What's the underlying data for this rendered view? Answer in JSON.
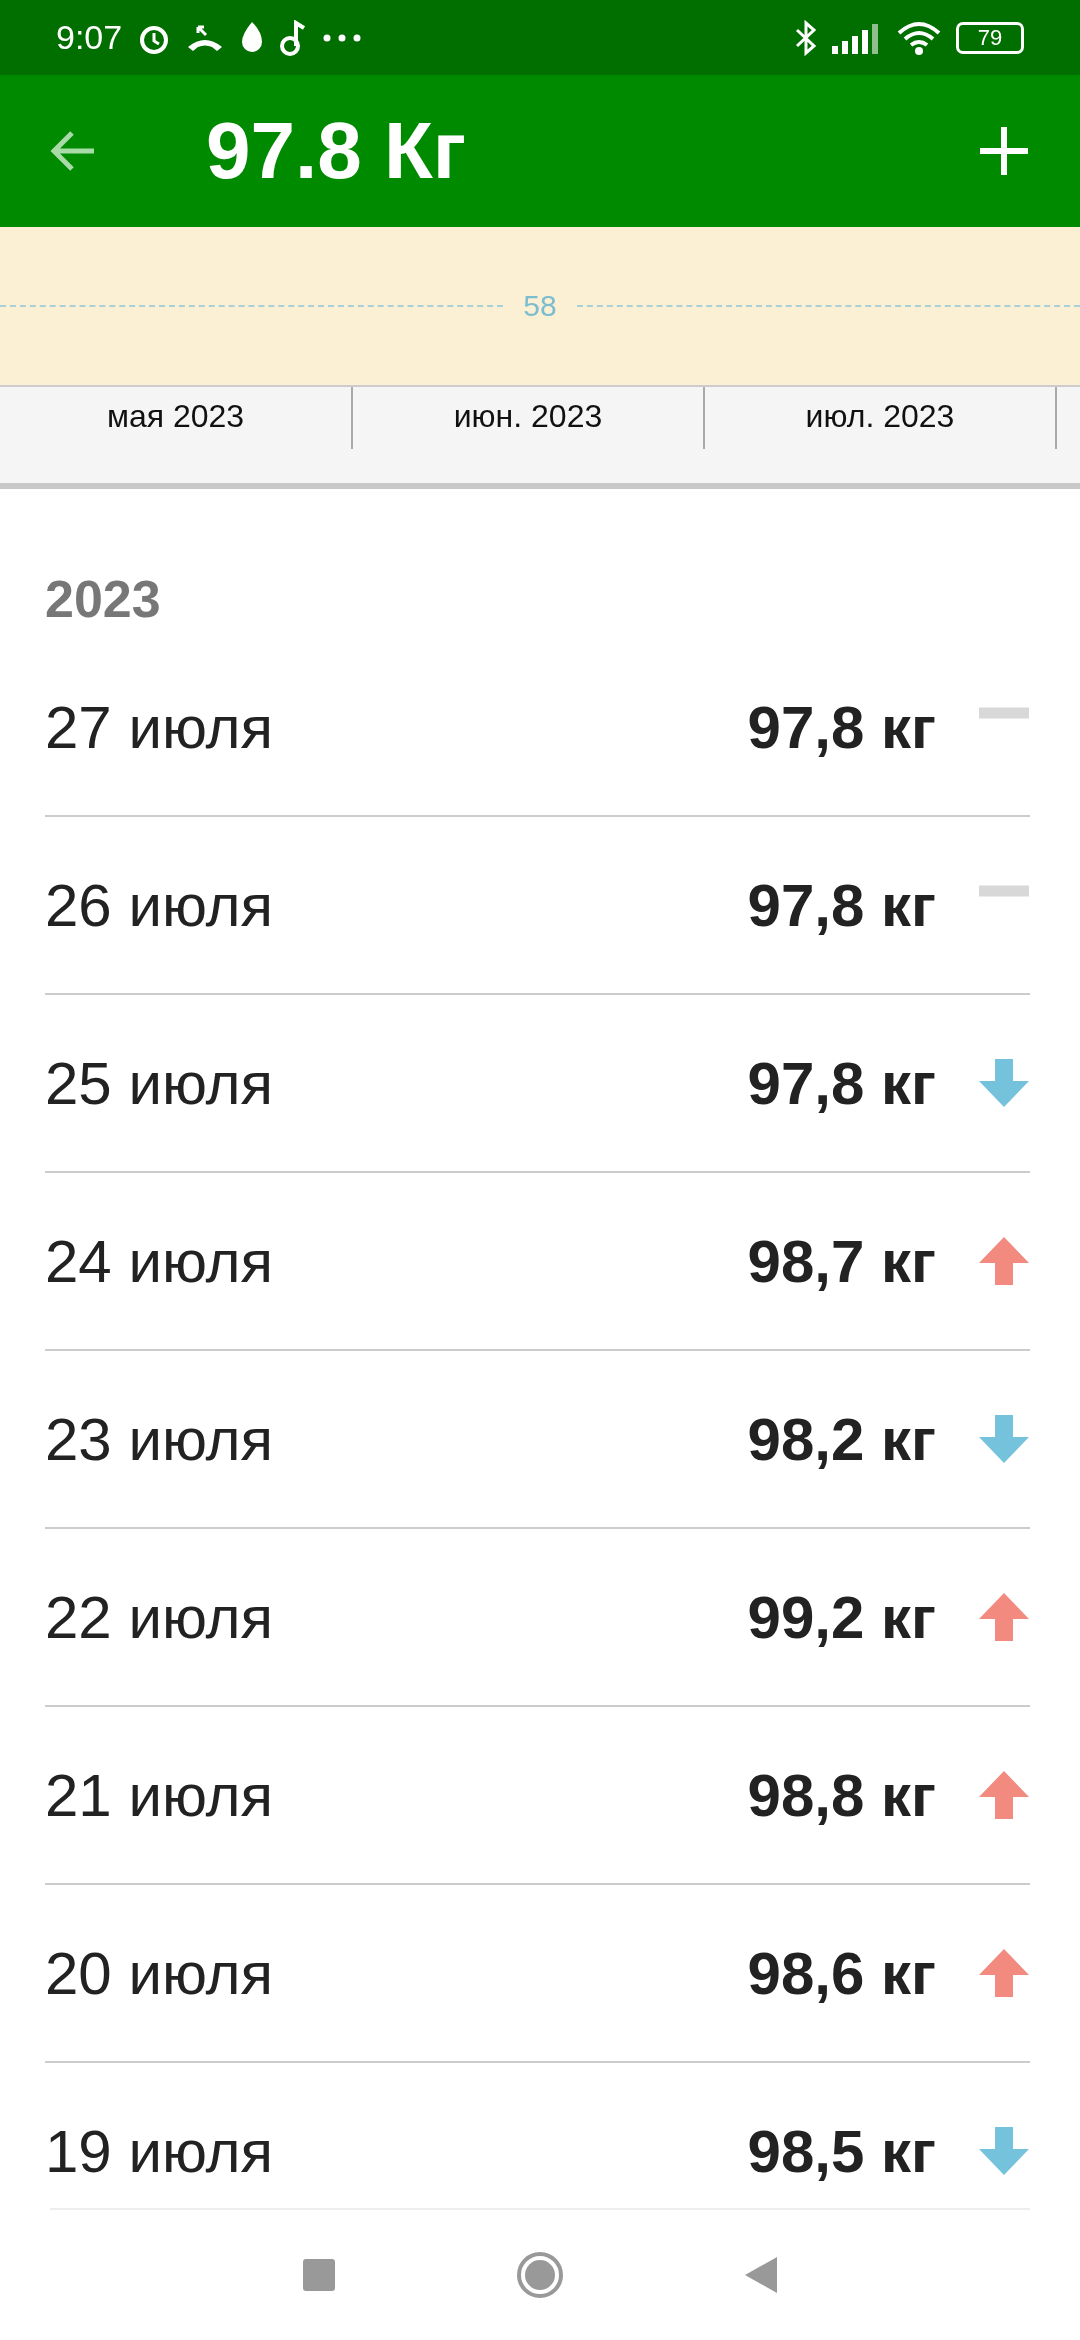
{
  "status_bar": {
    "time": "9:07",
    "battery": "79"
  },
  "app_bar": {
    "title": "97.8 Кг"
  },
  "chart": {
    "reference_label": "58",
    "months": [
      "мая 2023",
      "июн. 2023",
      "июл. 2023"
    ]
  },
  "year": "2023",
  "entries": [
    {
      "date": "27 июля",
      "weight": "97,8 кг",
      "kind": "flat"
    },
    {
      "date": "26 июля",
      "weight": "97,8 кг",
      "kind": "flat"
    },
    {
      "date": "25 июля",
      "weight": "97,8 кг",
      "kind": "down"
    },
    {
      "date": "24 июля",
      "weight": "98,7 кг",
      "kind": "up"
    },
    {
      "date": "23 июля",
      "weight": "98,2 кг",
      "kind": "down"
    },
    {
      "date": "22 июля",
      "weight": "99,2 кг",
      "kind": "up"
    },
    {
      "date": "21 июля",
      "weight": "98,8 кг",
      "kind": "up"
    },
    {
      "date": "20 июля",
      "weight": "98,6 кг",
      "kind": "up"
    },
    {
      "date": "19 июля",
      "weight": "98,5 кг",
      "kind": "down"
    }
  ]
}
